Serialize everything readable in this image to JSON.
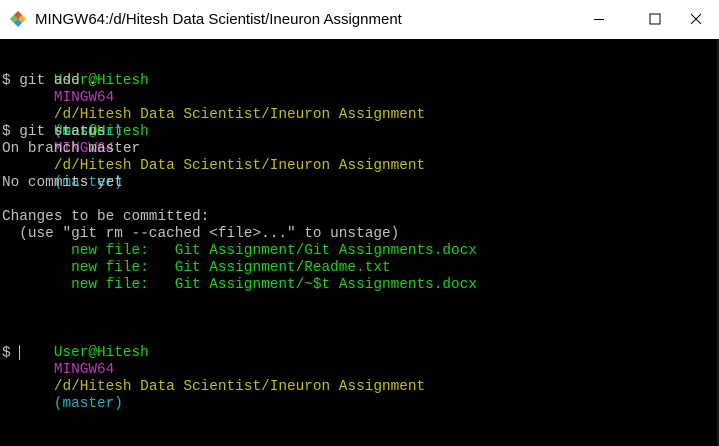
{
  "window": {
    "title": "MINGW64:/d/Hitesh Data Scientist/Ineuron Assignment",
    "controls": {
      "minimize": "–",
      "maximize": "☐",
      "close": "✕"
    }
  },
  "terminal": {
    "prompt": {
      "user": "User@Hitesh",
      "shell": "MINGW64",
      "path": "/d/Hitesh Data Scientist/Ineuron Assignment",
      "branch": "(master)",
      "symbol": "$"
    },
    "cmd1": " git add .",
    "cmd2": " git status",
    "on_branch": "On branch master",
    "no_commits": "No commits yet",
    "changes_header": "Changes to be committed:",
    "unstage_hint": "  (use \"git rm --cached <file>...\" to unstage)",
    "files": [
      "        new file:   Git Assignment/Git Assignments.docx",
      "        new file:   Git Assignment/Readme.txt",
      "        new file:   Git Assignment/~$t Assignments.docx"
    ]
  },
  "colors": {
    "user": "#17d317",
    "shell": "#bf36bf",
    "path": "#bfbf1d",
    "branch": "#1cb5c4",
    "text": "#c0c0c0",
    "background": "#000000"
  }
}
